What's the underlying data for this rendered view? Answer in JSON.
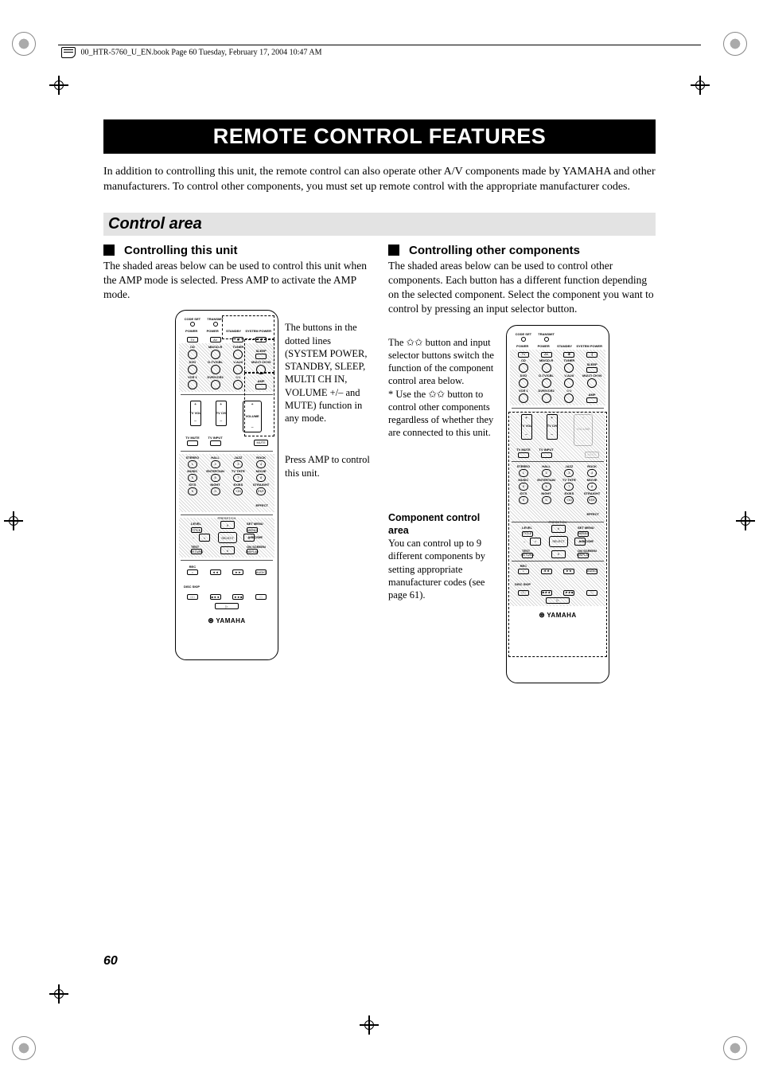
{
  "header_note": "00_HTR-5760_U_EN.book  Page 60  Tuesday, February 17, 2004  10:47 AM",
  "chapter_title": "REMOTE CONTROL FEATURES",
  "intro": "In addition to controlling this unit, the remote control can also operate other A/V components made by YAMAHA and other manufacturers. To control other components, you must set up remote control with the appropriate manufacturer codes.",
  "section": "Control area",
  "left": {
    "subhead": "Controlling this unit",
    "body": "The shaded areas below can be used to control this unit when the AMP mode is selected. Press AMP to activate the AMP mode.",
    "annot1": "The buttons in the dotted lines (SYSTEM POWER, STANDBY, SLEEP, MULTI CH IN, VOLUME +/– and MUTE) function in any mode.",
    "annot2": "Press AMP to control this unit."
  },
  "right": {
    "subhead": "Controlling other components",
    "body": "The shaded areas below can be used to control other components. Each button has a different function depending on the selected component. Select the component you want to control by pressing an input selector button.",
    "annot1_a": "The ✩✩ button and input selector buttons switch the function of the component control area below.",
    "annot1_b": "* Use the ✩✩ button to control other components regardless of whether they are connected to this unit.",
    "annot2_head": "Component control area",
    "annot2_body": "You can control up to 9 different components by setting appropriate manufacturer codes (see page 61)."
  },
  "remote": {
    "row1": [
      "CODE SET",
      "TRANSMIT",
      "",
      ""
    ],
    "row1b": [
      "POWER",
      "POWER",
      "STANDBY",
      "SYSTEM POWER"
    ],
    "row1c": [
      "TV",
      "AV",
      "✱",
      "❙"
    ],
    "row2_labels": [
      "CD",
      "MD/CD-R",
      "TUNER",
      "SLEEP"
    ],
    "row3_labels": [
      "DVD",
      "D-TV/CBL",
      "V-AUX",
      "MULTI CH IN"
    ],
    "row4_labels": [
      "VCR 1",
      "DVR/VCR2",
      "✩✩",
      "AMP"
    ],
    "vol_tv": "TV VOL",
    "vol_ch": "TV CH",
    "vol_main": "VOLUME",
    "mute_row": [
      "TV MUTE",
      "TV INPUT",
      "",
      "MUTE"
    ],
    "preset_rows": [
      [
        "STEREO",
        "HALL",
        "JAZZ",
        "ROCK"
      ],
      [
        "1",
        "2",
        "3",
        "4"
      ],
      [
        "MUSIC",
        "ENTERTAIN",
        "TV THTR",
        "MOVIE"
      ],
      [
        "5",
        "6",
        "7",
        "8"
      ],
      [
        "/DTS",
        "NIGHT",
        "EX/ES",
        "STRAIGHT"
      ],
      [
        "9",
        "0",
        "+10",
        "ENT"
      ]
    ],
    "effect_lbl": "EFFECT",
    "dpad": {
      "level": "LEVEL",
      "title": "TITLE",
      "preset": "PRESET/CH",
      "setmenu": "SET MENU",
      "menu": "MENU",
      "abcde": "A/B/C/D/E",
      "select": "SELECT",
      "test": "TEST",
      "return": "RETURN",
      "onscreen": "ON SCREEN",
      "display": "DISPLAY"
    },
    "transport1": [
      "REC",
      "◄◄",
      "►►",
      "AUDIO"
    ],
    "transport1b": "DISC SKIP",
    "transport2": [
      "□□",
      "■◄◄",
      "►►■",
      "□"
    ],
    "play": "▷",
    "logo": "YAMAHA"
  },
  "page_number": "60"
}
